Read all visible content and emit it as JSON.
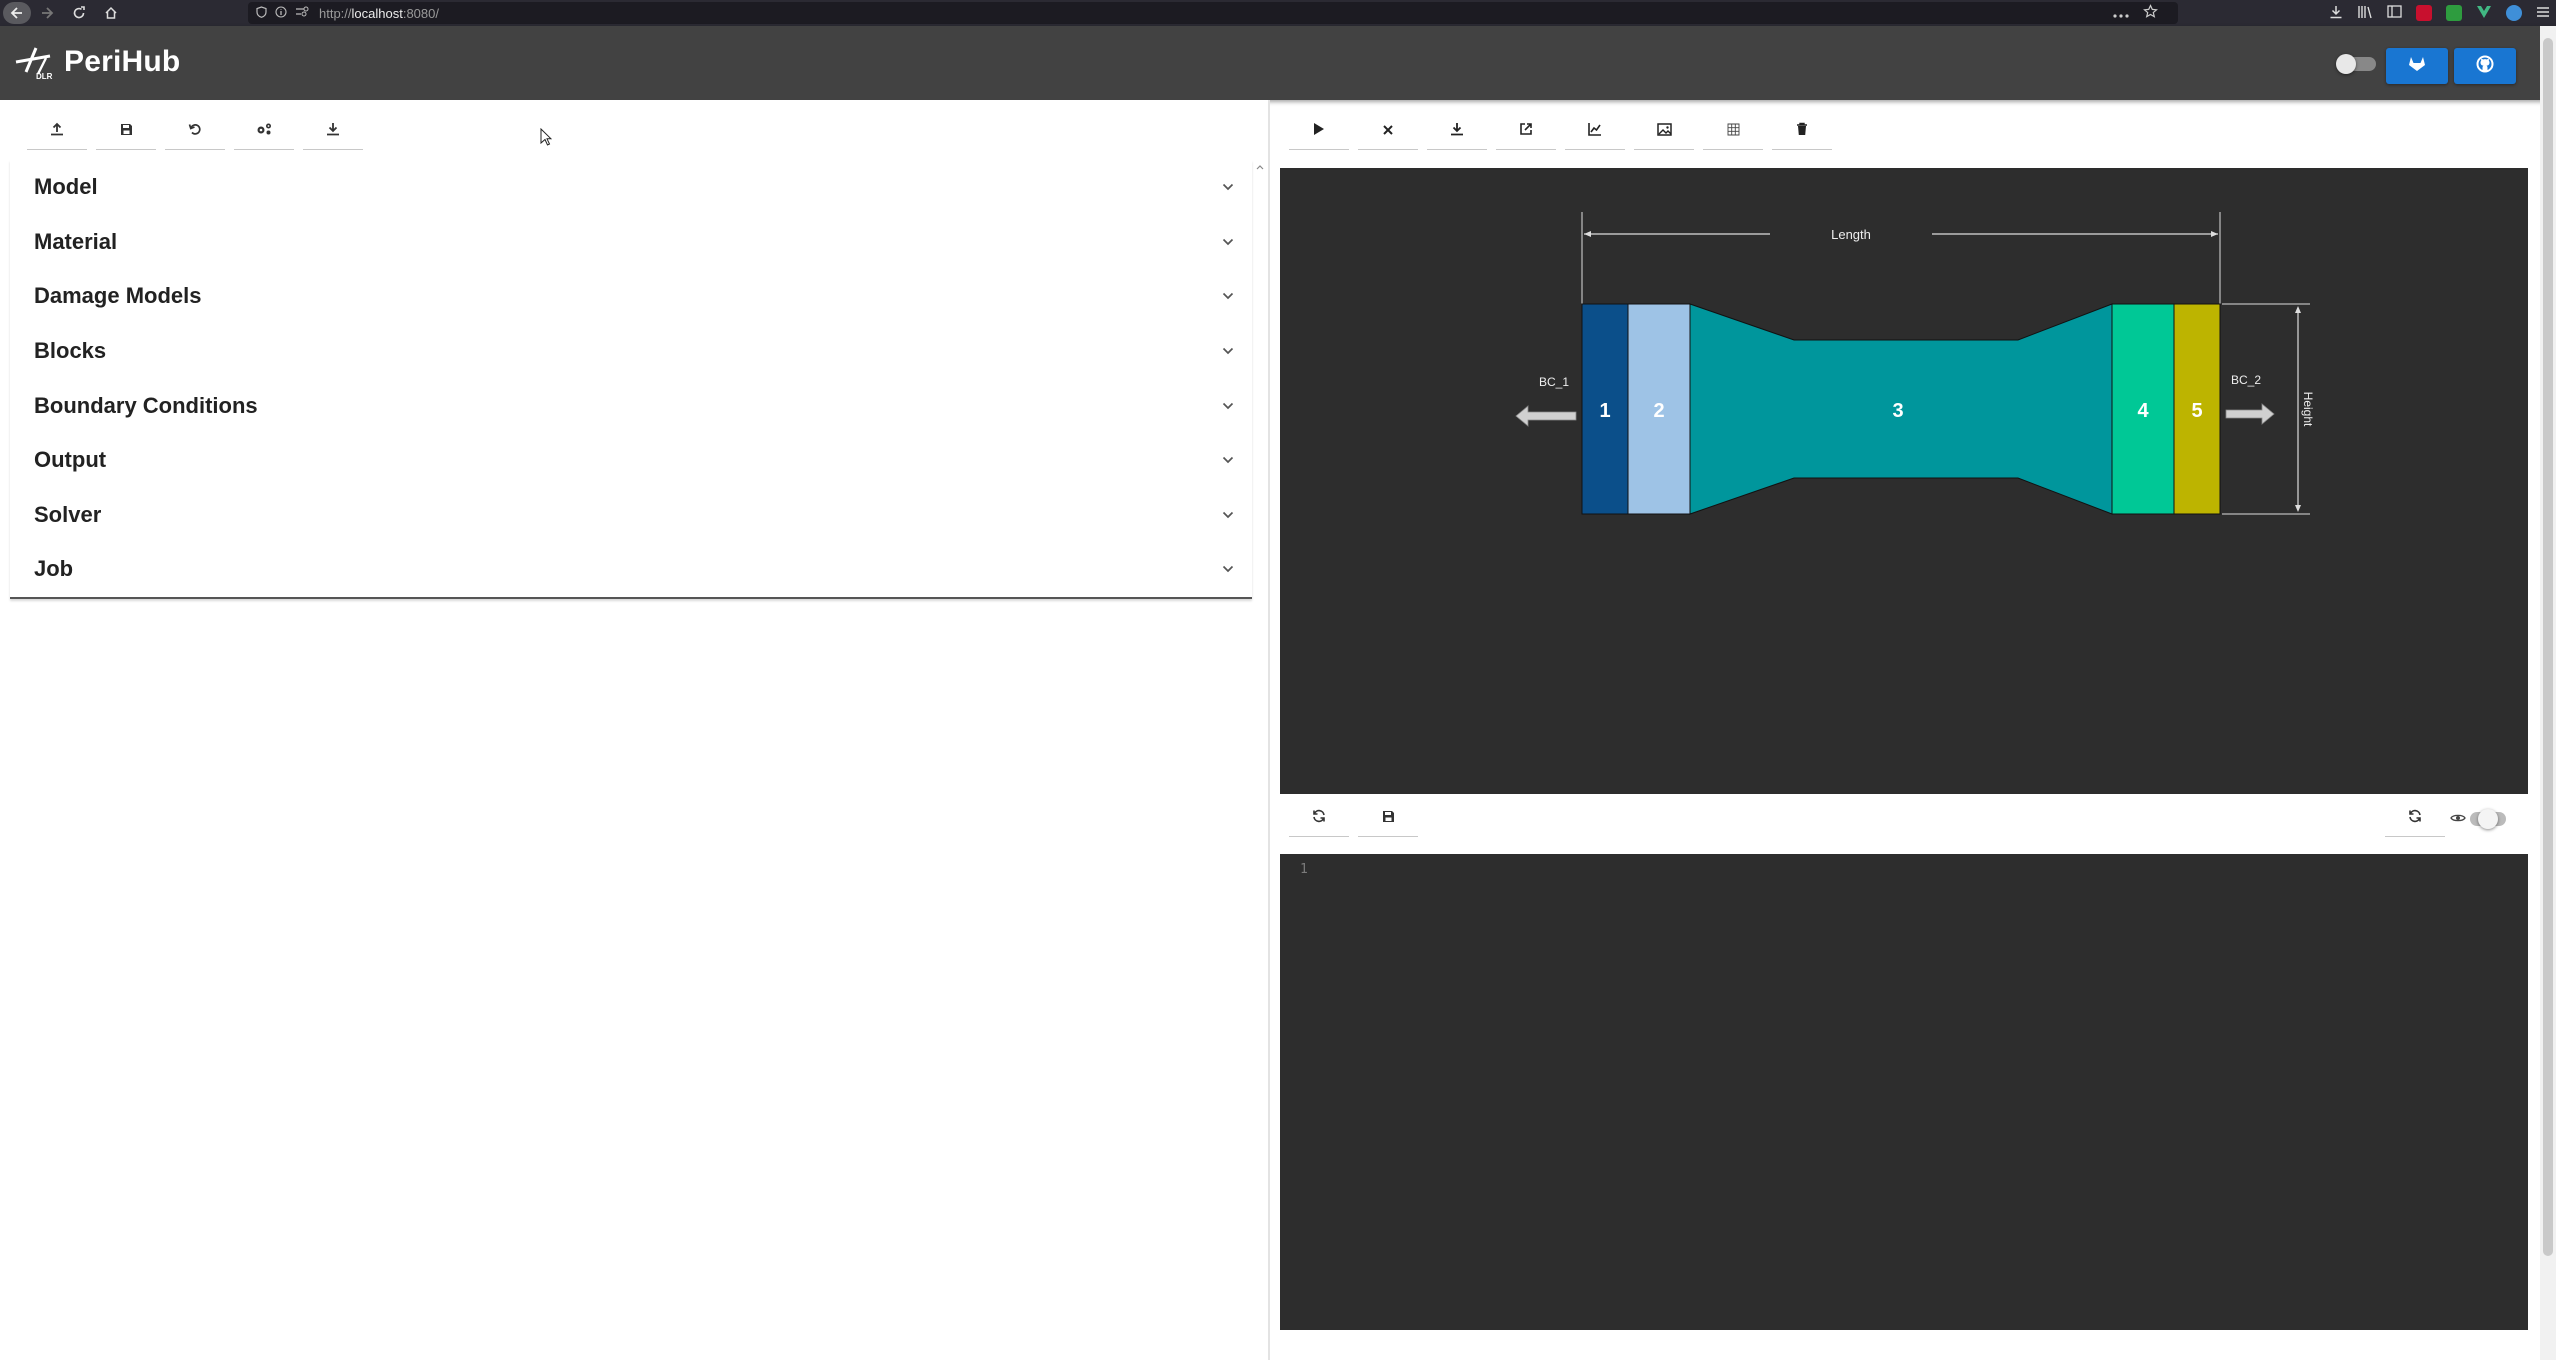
{
  "browser": {
    "url_prefix": "http://",
    "url_host": "localhost",
    "url_suffix": ":8080/"
  },
  "app": {
    "title": "PeriHub",
    "logo_caption": "DLR"
  },
  "model_toolbar": {
    "buttons": [
      "upload-icon",
      "save-icon",
      "reset-icon",
      "settings-icon",
      "download-icon"
    ]
  },
  "sections": [
    {
      "label": "Model"
    },
    {
      "label": "Material"
    },
    {
      "label": "Damage Models"
    },
    {
      "label": "Blocks"
    },
    {
      "label": "Boundary Conditions"
    },
    {
      "label": "Output"
    },
    {
      "label": "Solver"
    },
    {
      "label": "Job"
    }
  ],
  "viewer_toolbar": {
    "buttons": [
      "play-icon",
      "close-icon",
      "download-icon",
      "open-external-icon",
      "chart-icon",
      "image-icon",
      "mesh-icon",
      "delete-icon"
    ]
  },
  "model_image": {
    "length_label": "Length",
    "height_label": "Height",
    "bc_left": "BC_1",
    "bc_right": "BC_2",
    "blocks": [
      {
        "label": "1",
        "color": "#0b4f8a"
      },
      {
        "label": "2",
        "color": "#9ec3e6"
      },
      {
        "label": "3",
        "color": "#00969c"
      },
      {
        "label": "4",
        "color": "#00c896"
      },
      {
        "label": "5",
        "color": "#bdb400"
      }
    ]
  },
  "editor": {
    "line_number": "1",
    "content": ""
  },
  "colors": {
    "header_bg": "#424242",
    "accent": "#1976d2",
    "viewer_bg": "#2d2d2d"
  }
}
